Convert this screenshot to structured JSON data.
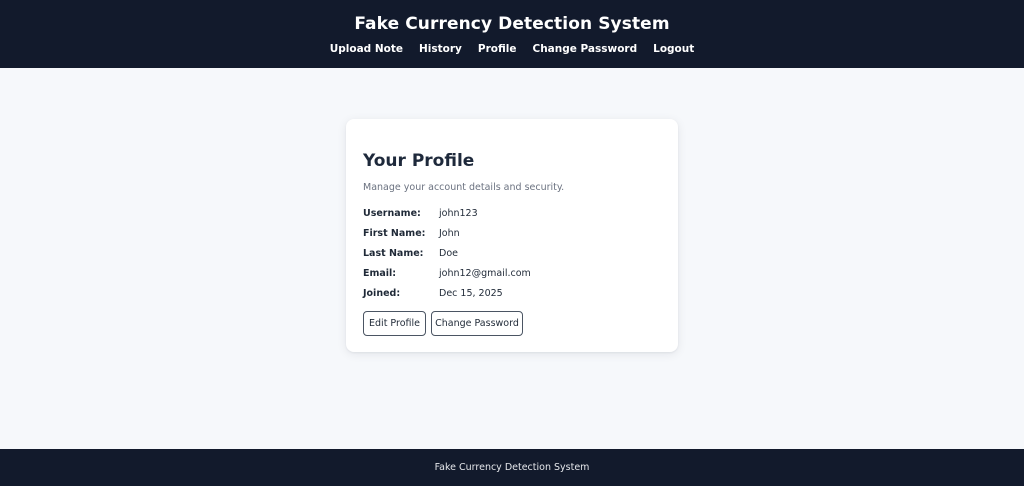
{
  "header": {
    "title": "Fake Currency Detection System",
    "nav": [
      {
        "label": "Upload Note"
      },
      {
        "label": "History"
      },
      {
        "label": "Profile"
      },
      {
        "label": "Change Password"
      },
      {
        "label": "Logout"
      }
    ]
  },
  "profile": {
    "title": "Your Profile",
    "subtitle": "Manage your account details and security.",
    "fields": [
      {
        "label": "Username:",
        "value": "john123"
      },
      {
        "label": "First Name:",
        "value": "John"
      },
      {
        "label": "Last Name:",
        "value": "Doe"
      },
      {
        "label": "Email:",
        "value": "john12@gmail.com"
      },
      {
        "label": "Joined:",
        "value": "Dec 15, 2025"
      }
    ],
    "buttons": {
      "edit_profile": "Edit Profile",
      "change_password": "Change Password"
    }
  },
  "footer": {
    "text": "Fake Currency Detection System"
  },
  "colors": {
    "header_bg": "#121a2c",
    "page_bg": "#f6f8fb",
    "card_bg": "#ffffff",
    "text_primary": "#1e293b",
    "text_muted": "#6b7280"
  }
}
